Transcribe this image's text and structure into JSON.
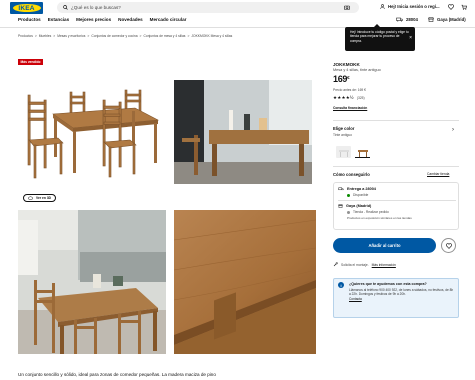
{
  "header": {
    "logo_text": "IKEA",
    "search_placeholder": "¿Qué es lo que buscas?",
    "user_label": "Hej! Inicia sesión o regí...",
    "store_label": "Gaya (Madrid)",
    "postal_code": "28004"
  },
  "nav": [
    "Productos",
    "Estancias",
    "Mejores precios",
    "Novedades",
    "Mercado circular"
  ],
  "breadcrumbs": [
    "Productos",
    ">",
    "Muebles",
    ">",
    "Mesas y escritorios",
    ">",
    "Conjuntos de comedor y cocina",
    ">",
    "Conjuntos de mesa y 4 sillas",
    ">",
    "JOKKMOKK Mesa y 4 sillas"
  ],
  "tooltip": "Hej! Introduce tu código postal y elige tu tienda para mejorar tu proceso de compra.",
  "badge": "Más vendido",
  "view_3d_label": "Ver en 3D",
  "product": {
    "name": "JOKKMOKK",
    "subtitle": "Mesa y 4 sillas, tinte antiguo",
    "price": "169",
    "currency": "€",
    "price_per": "Precio antes de: 169 €",
    "rating_count": "(325)",
    "compare_link": "Consulta financiación",
    "color_heading": "Elige color",
    "color_value": "Tinte antiguo"
  },
  "delivery": {
    "heading": "Cómo conseguirlo",
    "change_link": "Cambiar tienda",
    "ship_title": "Entrega a 28004",
    "ship_status": "Disponible",
    "store_title": "Gaya (Madrid)",
    "store_status": "Tienda - Realizar pedido",
    "store_note": "Productos en exposición similares en las tiendas"
  },
  "cart_button": "Añadir al carrito",
  "assembly_text": "Solicita el montaje.",
  "assembly_link": "Más información",
  "help": {
    "title": "¿Quieres que te ayudemos con esta compra?",
    "body": "Llámanos al teléfono 900 400 922, de lunes a sábados, no festivos, de 8h a 22h. Domingos y festivos de 9h a 20h.",
    "link": "Contacta"
  },
  "description": "Un conjunto sencillo y sólido, ideal para zonas de comedor pequeñas. La madera maciza de pino",
  "colors": {
    "brand_blue": "#0058a3",
    "brand_yellow": "#ffdb00",
    "badge_red": "#cc0008",
    "available_green": "#0a8a00",
    "wood": "#9b6a3a"
  }
}
